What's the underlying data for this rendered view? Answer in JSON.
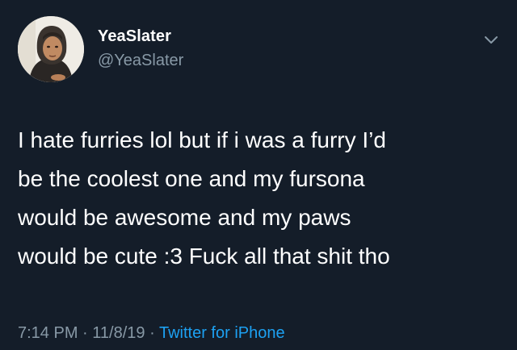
{
  "user": {
    "display_name": "YeaSlater",
    "handle": "@YeaSlater",
    "avatar_icon": "profile-photo"
  },
  "menu": {
    "icon": "chevron-down-icon"
  },
  "tweet": {
    "lines": [
      "I hate furries lol but if i was a furry I’d",
      "be the coolest one and my fursona",
      "would be awesome and my paws",
      "would be cute :3 Fuck all that shit tho"
    ]
  },
  "meta": {
    "time": "7:14 PM",
    "separator": "·",
    "date": "11/8/19",
    "source": "Twitter for iPhone"
  },
  "colors": {
    "background": "#141d29",
    "text": "#ffffff",
    "secondary": "#8899a6",
    "link": "#1da1f2"
  }
}
